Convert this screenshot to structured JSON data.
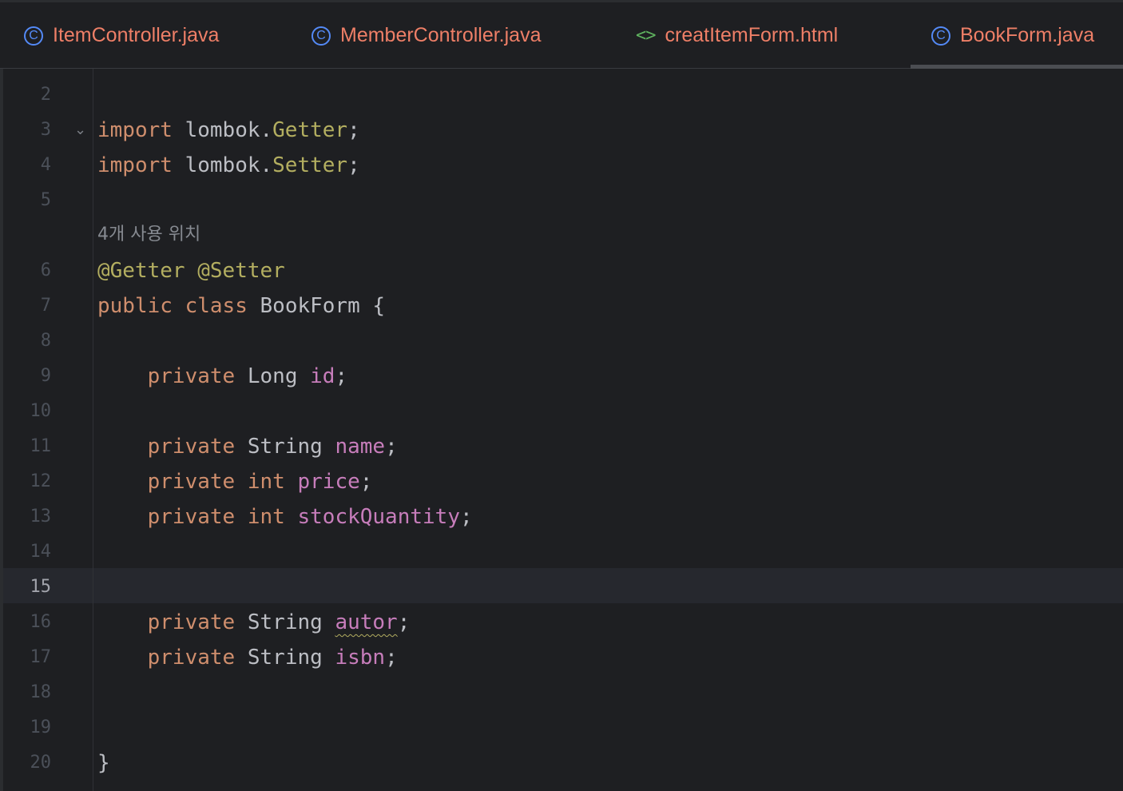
{
  "tabs": [
    {
      "label": "ItemController.java",
      "icon": "class-icon",
      "color": "#ee7f67"
    },
    {
      "label": "MemberController.java",
      "icon": "class-icon",
      "color": "#ee7f67"
    },
    {
      "label": "creatItemForm.html",
      "icon": "html-icon",
      "color": "#ee7f67"
    },
    {
      "label": "BookForm.java",
      "icon": "class-icon",
      "color": "#ee7f67",
      "active": true
    }
  ],
  "editor": {
    "current_line": "15",
    "usage_hint": "4개 사용 위치",
    "lines": [
      {
        "n": "2"
      },
      {
        "n": "3",
        "t": [
          [
            "kw",
            "import"
          ],
          [
            "typ",
            " lombok."
          ],
          [
            "cls",
            "Getter"
          ],
          [
            "typ",
            ";"
          ]
        ]
      },
      {
        "n": "4",
        "t": [
          [
            "kw",
            "import"
          ],
          [
            "typ",
            " lombok."
          ],
          [
            "cls",
            "Setter"
          ],
          [
            "typ",
            ";"
          ]
        ]
      },
      {
        "n": "5"
      },
      {
        "n": "6",
        "t": [
          [
            "ann",
            "@Getter"
          ],
          [
            "typ",
            " "
          ],
          [
            "ann",
            "@Setter"
          ]
        ]
      },
      {
        "n": "7",
        "t": [
          [
            "kw",
            "public"
          ],
          [
            "typ",
            " "
          ],
          [
            "kw",
            "class"
          ],
          [
            "typ",
            " BookForm {"
          ]
        ]
      },
      {
        "n": "8"
      },
      {
        "n": "9",
        "t": [
          [
            "typ",
            "    "
          ],
          [
            "kw",
            "private"
          ],
          [
            "typ",
            " Long "
          ],
          [
            "field",
            "id"
          ],
          [
            "typ",
            ";"
          ]
        ]
      },
      {
        "n": "10"
      },
      {
        "n": "11",
        "t": [
          [
            "typ",
            "    "
          ],
          [
            "kw",
            "private"
          ],
          [
            "typ",
            " String "
          ],
          [
            "field",
            "name"
          ],
          [
            "typ",
            ";"
          ]
        ]
      },
      {
        "n": "12",
        "t": [
          [
            "typ",
            "    "
          ],
          [
            "kw",
            "private"
          ],
          [
            "typ",
            " "
          ],
          [
            "kw",
            "int"
          ],
          [
            "typ",
            " "
          ],
          [
            "field",
            "price"
          ],
          [
            "typ",
            ";"
          ]
        ]
      },
      {
        "n": "13",
        "t": [
          [
            "typ",
            "    "
          ],
          [
            "kw",
            "private"
          ],
          [
            "typ",
            " "
          ],
          [
            "kw",
            "int"
          ],
          [
            "typ",
            " "
          ],
          [
            "field",
            "stockQuantity"
          ],
          [
            "typ",
            ";"
          ]
        ]
      },
      {
        "n": "14"
      },
      {
        "n": "15"
      },
      {
        "n": "16",
        "t": [
          [
            "typ",
            "    "
          ],
          [
            "kw",
            "private"
          ],
          [
            "typ",
            " String "
          ],
          [
            "field warn",
            "autor"
          ],
          [
            "typ",
            ";"
          ]
        ]
      },
      {
        "n": "17",
        "t": [
          [
            "typ",
            "    "
          ],
          [
            "kw",
            "private"
          ],
          [
            "typ",
            " String "
          ],
          [
            "field",
            "isbn"
          ],
          [
            "typ",
            ";"
          ]
        ]
      },
      {
        "n": "18"
      },
      {
        "n": "19"
      },
      {
        "n": "20",
        "t": [
          [
            "typ",
            "}"
          ]
        ]
      }
    ]
  }
}
